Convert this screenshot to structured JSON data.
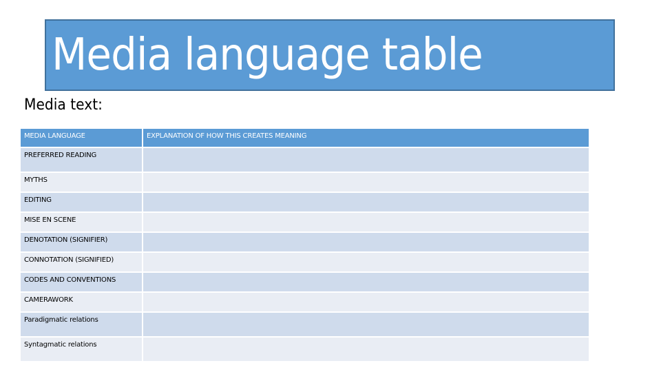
{
  "title": "Media language table",
  "subtitle": "Media text:",
  "table": {
    "headers": [
      "MEDIA LANGUAGE",
      "EXPLANATION OF HOW THIS CREATES MEANING"
    ],
    "rows": [
      {
        "label": "PREFERRED READING",
        "explanation": ""
      },
      {
        "label": "MYTHS",
        "explanation": ""
      },
      {
        "label": "EDITING",
        "explanation": ""
      },
      {
        "label": "MISE EN SCENE",
        "explanation": ""
      },
      {
        "label": "DENOTATION (SIGNIFIER)",
        "explanation": ""
      },
      {
        "label": "CONNOTATION (SIGNIFIED)",
        "explanation": ""
      },
      {
        "label": "CODES AND CONVENTIONS",
        "explanation": ""
      },
      {
        "label": "CAMERAWORK",
        "explanation": ""
      },
      {
        "label": "Paradigmatic relations",
        "explanation": ""
      },
      {
        "label": "Syntagmatic relations",
        "explanation": ""
      }
    ]
  },
  "colors": {
    "accent": "#5b9bd5",
    "title_border": "#41719c",
    "row_dark": "#cfdbec",
    "row_light": "#e9edf4"
  }
}
